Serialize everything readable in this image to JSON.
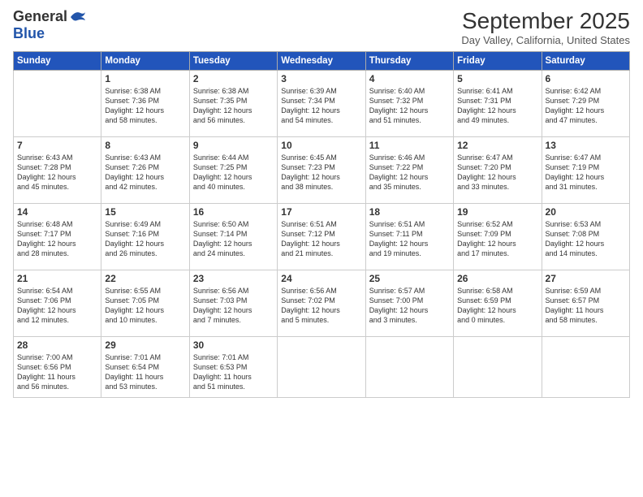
{
  "header": {
    "logo_general": "General",
    "logo_blue": "Blue",
    "month_title": "September 2025",
    "location": "Day Valley, California, United States"
  },
  "weekdays": [
    "Sunday",
    "Monday",
    "Tuesday",
    "Wednesday",
    "Thursday",
    "Friday",
    "Saturday"
  ],
  "weeks": [
    [
      {
        "day": "",
        "info": ""
      },
      {
        "day": "1",
        "info": "Sunrise: 6:38 AM\nSunset: 7:36 PM\nDaylight: 12 hours\nand 58 minutes."
      },
      {
        "day": "2",
        "info": "Sunrise: 6:38 AM\nSunset: 7:35 PM\nDaylight: 12 hours\nand 56 minutes."
      },
      {
        "day": "3",
        "info": "Sunrise: 6:39 AM\nSunset: 7:34 PM\nDaylight: 12 hours\nand 54 minutes."
      },
      {
        "day": "4",
        "info": "Sunrise: 6:40 AM\nSunset: 7:32 PM\nDaylight: 12 hours\nand 51 minutes."
      },
      {
        "day": "5",
        "info": "Sunrise: 6:41 AM\nSunset: 7:31 PM\nDaylight: 12 hours\nand 49 minutes."
      },
      {
        "day": "6",
        "info": "Sunrise: 6:42 AM\nSunset: 7:29 PM\nDaylight: 12 hours\nand 47 minutes."
      }
    ],
    [
      {
        "day": "7",
        "info": "Sunrise: 6:43 AM\nSunset: 7:28 PM\nDaylight: 12 hours\nand 45 minutes."
      },
      {
        "day": "8",
        "info": "Sunrise: 6:43 AM\nSunset: 7:26 PM\nDaylight: 12 hours\nand 42 minutes."
      },
      {
        "day": "9",
        "info": "Sunrise: 6:44 AM\nSunset: 7:25 PM\nDaylight: 12 hours\nand 40 minutes."
      },
      {
        "day": "10",
        "info": "Sunrise: 6:45 AM\nSunset: 7:23 PM\nDaylight: 12 hours\nand 38 minutes."
      },
      {
        "day": "11",
        "info": "Sunrise: 6:46 AM\nSunset: 7:22 PM\nDaylight: 12 hours\nand 35 minutes."
      },
      {
        "day": "12",
        "info": "Sunrise: 6:47 AM\nSunset: 7:20 PM\nDaylight: 12 hours\nand 33 minutes."
      },
      {
        "day": "13",
        "info": "Sunrise: 6:47 AM\nSunset: 7:19 PM\nDaylight: 12 hours\nand 31 minutes."
      }
    ],
    [
      {
        "day": "14",
        "info": "Sunrise: 6:48 AM\nSunset: 7:17 PM\nDaylight: 12 hours\nand 28 minutes."
      },
      {
        "day": "15",
        "info": "Sunrise: 6:49 AM\nSunset: 7:16 PM\nDaylight: 12 hours\nand 26 minutes."
      },
      {
        "day": "16",
        "info": "Sunrise: 6:50 AM\nSunset: 7:14 PM\nDaylight: 12 hours\nand 24 minutes."
      },
      {
        "day": "17",
        "info": "Sunrise: 6:51 AM\nSunset: 7:12 PM\nDaylight: 12 hours\nand 21 minutes."
      },
      {
        "day": "18",
        "info": "Sunrise: 6:51 AM\nSunset: 7:11 PM\nDaylight: 12 hours\nand 19 minutes."
      },
      {
        "day": "19",
        "info": "Sunrise: 6:52 AM\nSunset: 7:09 PM\nDaylight: 12 hours\nand 17 minutes."
      },
      {
        "day": "20",
        "info": "Sunrise: 6:53 AM\nSunset: 7:08 PM\nDaylight: 12 hours\nand 14 minutes."
      }
    ],
    [
      {
        "day": "21",
        "info": "Sunrise: 6:54 AM\nSunset: 7:06 PM\nDaylight: 12 hours\nand 12 minutes."
      },
      {
        "day": "22",
        "info": "Sunrise: 6:55 AM\nSunset: 7:05 PM\nDaylight: 12 hours\nand 10 minutes."
      },
      {
        "day": "23",
        "info": "Sunrise: 6:56 AM\nSunset: 7:03 PM\nDaylight: 12 hours\nand 7 minutes."
      },
      {
        "day": "24",
        "info": "Sunrise: 6:56 AM\nSunset: 7:02 PM\nDaylight: 12 hours\nand 5 minutes."
      },
      {
        "day": "25",
        "info": "Sunrise: 6:57 AM\nSunset: 7:00 PM\nDaylight: 12 hours\nand 3 minutes."
      },
      {
        "day": "26",
        "info": "Sunrise: 6:58 AM\nSunset: 6:59 PM\nDaylight: 12 hours\nand 0 minutes."
      },
      {
        "day": "27",
        "info": "Sunrise: 6:59 AM\nSunset: 6:57 PM\nDaylight: 11 hours\nand 58 minutes."
      }
    ],
    [
      {
        "day": "28",
        "info": "Sunrise: 7:00 AM\nSunset: 6:56 PM\nDaylight: 11 hours\nand 56 minutes."
      },
      {
        "day": "29",
        "info": "Sunrise: 7:01 AM\nSunset: 6:54 PM\nDaylight: 11 hours\nand 53 minutes."
      },
      {
        "day": "30",
        "info": "Sunrise: 7:01 AM\nSunset: 6:53 PM\nDaylight: 11 hours\nand 51 minutes."
      },
      {
        "day": "",
        "info": ""
      },
      {
        "day": "",
        "info": ""
      },
      {
        "day": "",
        "info": ""
      },
      {
        "day": "",
        "info": ""
      }
    ]
  ]
}
